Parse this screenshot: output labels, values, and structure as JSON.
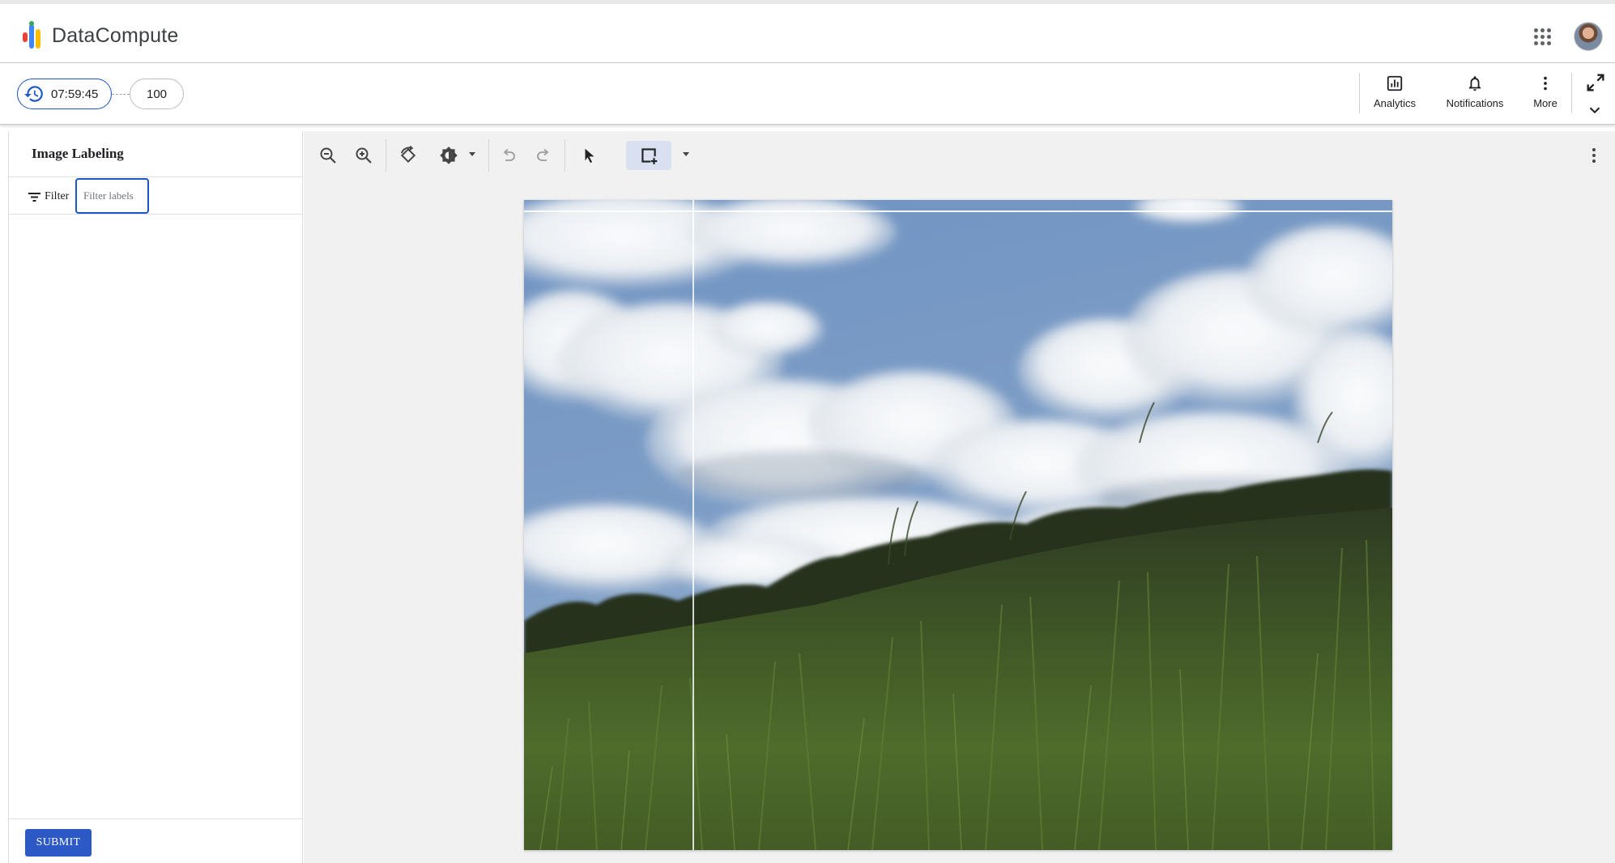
{
  "app": {
    "name": "DataCompute"
  },
  "task": {
    "timer": "07:59:45",
    "count": "100"
  },
  "actions": {
    "analytics": "Analytics",
    "notifications": "Notifications",
    "more": "More"
  },
  "panel": {
    "title": "Image Labeling",
    "filter_label": "Filter",
    "filter_placeholder": "Filter labels",
    "submit_label": "SUBMIT"
  },
  "toolbar": {
    "tools": [
      "zoom-out-icon",
      "zoom-in-icon",
      "rotate-icon",
      "brightness-icon",
      "undo-icon",
      "redo-icon",
      "select-pointer-icon",
      "bounding-box-icon"
    ],
    "active_tool": "bounding-box-icon"
  },
  "colors": {
    "accent": "#1a56c4",
    "submit": "#2c59c5",
    "canvas_bg": "#f1f1f1"
  }
}
